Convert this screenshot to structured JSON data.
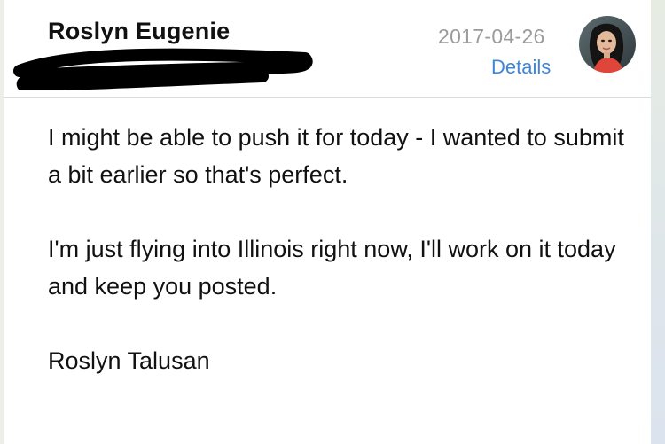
{
  "header": {
    "sender_name": "Roslyn Eugenie",
    "recipient_text": "...",
    "date": "2017-04-26",
    "details_label": "Details",
    "avatar_icon": "profile-photo"
  },
  "message": {
    "paragraphs": [
      "I might be able to push it for today - I wanted to submit a bit earlier so that's perfect.",
      "I'm just flying into Illinois right now, I'll work on it today and keep you posted.",
      "Roslyn Talusan"
    ]
  },
  "colors": {
    "link": "#3f86d8",
    "muted": "#9b9b9b",
    "text": "#111111",
    "redaction": "#000000"
  }
}
